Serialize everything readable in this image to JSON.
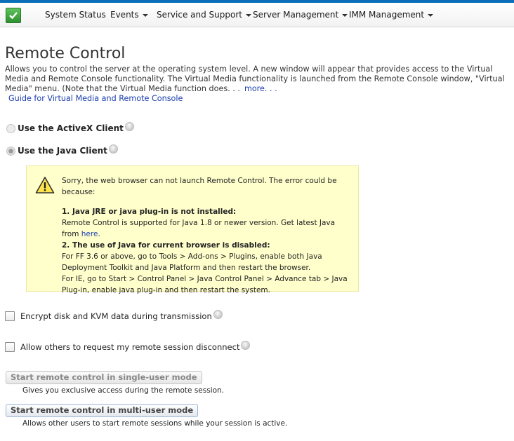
{
  "nav": {
    "items": [
      {
        "label": "System Status",
        "dropdown": false
      },
      {
        "label": "Events",
        "dropdown": true
      },
      {
        "label": "Service and Support",
        "dropdown": true
      },
      {
        "label": "Server Management",
        "dropdown": true
      },
      {
        "label": "IMM Management",
        "dropdown": true
      }
    ]
  },
  "page": {
    "title": "Remote Control",
    "description": "Allows you to control the server at the operating system level. A new window will appear that provides access to the Virtual Media and Remote Console functionality. The Virtual Media functionality is launched from the Remote Console window, \"Virtual Media\" menu. (Note that the Virtual Media function does. . .",
    "more_link": "more. . .",
    "guide_link": "Guide for Virtual Media and Remote Console"
  },
  "client": {
    "activex_label": "Use the ActiveX Client",
    "java_label": "Use the Java Client",
    "selected": "java"
  },
  "warning": {
    "intro": "Sorry, the web browser can not launch Remote Control. The error could be because:",
    "item1_title": "1. Java JRE or java plug-in is not installed:",
    "item1_text": "Remote Control is supported for Java 1.8 or newer version. Get latest Java from",
    "item1_link": "here",
    "item1_end": ".",
    "item2_title": "2. The use of Java for current browser is disabled:",
    "item2_ff": "For FF 3.6 or above, go to Tools > Add-ons > Plugins, enable both Java Deployment Toolkit and Java Platform and then restart the browser.",
    "item2_ie": "For IE, go to Start > Control Panel > Java Control Panel > Advance tab > Java Plug-in, enable java plug-in and then restart the system."
  },
  "options": {
    "encrypt_label": "Encrypt disk and KVM data during transmission",
    "encrypt_checked": false,
    "allow_disconnect_label": "Allow others to request my remote session disconnect",
    "allow_disconnect_checked": false
  },
  "actions": {
    "single_user_label": "Start remote control in single-user mode",
    "single_user_desc": "Gives you exclusive access during the remote session.",
    "multi_user_label": "Start remote control in multi-user mode",
    "multi_user_desc": "Allows other users to start remote sessions while your session is active."
  },
  "colors": {
    "accent": "#0a6fb8",
    "link": "#1b3fb0",
    "warning_bg": "#ffffcc"
  }
}
